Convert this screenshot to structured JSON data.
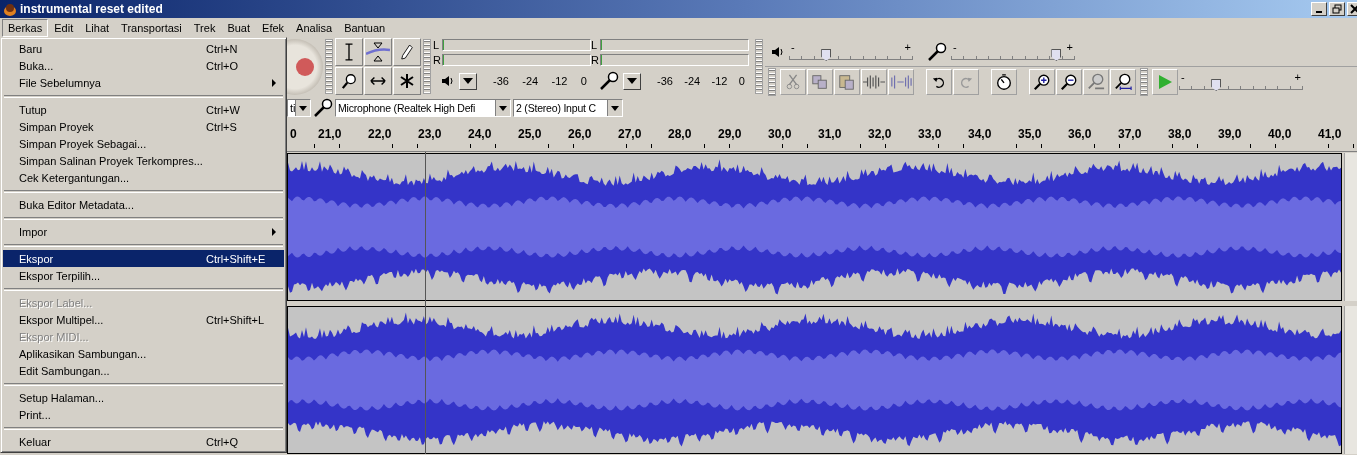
{
  "window": {
    "title": "instrumental reset edited"
  },
  "menu_bar": [
    {
      "label": "Berkas",
      "selected": true
    },
    {
      "label": "Edit",
      "selected": false
    },
    {
      "label": "Lihat",
      "selected": false
    },
    {
      "label": "Transportasi",
      "selected": false
    },
    {
      "label": "Trek",
      "selected": false
    },
    {
      "label": "Buat",
      "selected": false
    },
    {
      "label": "Efek",
      "selected": false
    },
    {
      "label": "Analisa",
      "selected": false
    },
    {
      "label": "Bantuan",
      "selected": false
    }
  ],
  "file_menu": [
    {
      "kind": "item",
      "label": "Baru",
      "shortcut": "Ctrl+N",
      "selected": false,
      "disabled": false,
      "submenu": false
    },
    {
      "kind": "item",
      "label": "Buka...",
      "shortcut": "Ctrl+O",
      "selected": false,
      "disabled": false,
      "submenu": false
    },
    {
      "kind": "item",
      "label": "File Sebelumnya",
      "selected": false,
      "disabled": false,
      "submenu": true
    },
    {
      "kind": "separator"
    },
    {
      "kind": "item",
      "label": "Tutup",
      "shortcut": "Ctrl+W",
      "selected": false,
      "disabled": false,
      "submenu": false
    },
    {
      "kind": "item",
      "label": "Simpan Proyek",
      "shortcut": "Ctrl+S",
      "selected": false,
      "disabled": false,
      "submenu": false
    },
    {
      "kind": "item",
      "label": "Simpan Proyek Sebagai...",
      "selected": false,
      "disabled": false,
      "submenu": false
    },
    {
      "kind": "item",
      "label": "Simpan Salinan Proyek Terkompres...",
      "selected": false,
      "disabled": false,
      "submenu": false
    },
    {
      "kind": "item",
      "label": "Cek Ketergantungan...",
      "selected": false,
      "disabled": false,
      "submenu": false
    },
    {
      "kind": "separator"
    },
    {
      "kind": "item",
      "label": "Buka Editor Metadata...",
      "selected": false,
      "disabled": false,
      "submenu": false
    },
    {
      "kind": "separator"
    },
    {
      "kind": "item",
      "label": "Impor",
      "selected": false,
      "disabled": false,
      "submenu": true
    },
    {
      "kind": "separator"
    },
    {
      "kind": "item",
      "label": "Ekspor",
      "shortcut": "Ctrl+Shift+E",
      "selected": true,
      "disabled": false,
      "submenu": false
    },
    {
      "kind": "item",
      "label": "Ekspor Terpilih...",
      "selected": false,
      "disabled": false,
      "submenu": false
    },
    {
      "kind": "separator"
    },
    {
      "kind": "item",
      "label": "Ekspor Label...",
      "selected": false,
      "disabled": true,
      "submenu": false
    },
    {
      "kind": "item",
      "label": "Ekspor Multipel...",
      "shortcut": "Ctrl+Shift+L",
      "selected": false,
      "disabled": false,
      "submenu": false
    },
    {
      "kind": "item",
      "label": "Ekspor MIDI...",
      "selected": false,
      "disabled": true,
      "submenu": false
    },
    {
      "kind": "item",
      "label": "Aplikasikan Sambungan...",
      "selected": false,
      "disabled": false,
      "submenu": false
    },
    {
      "kind": "item",
      "label": "Edit Sambungan...",
      "selected": false,
      "disabled": false,
      "submenu": false
    },
    {
      "kind": "separator"
    },
    {
      "kind": "item",
      "label": "Setup Halaman...",
      "selected": false,
      "disabled": false,
      "submenu": false
    },
    {
      "kind": "item",
      "label": "Print...",
      "selected": false,
      "disabled": false,
      "submenu": false
    },
    {
      "kind": "separator"
    },
    {
      "kind": "item",
      "label": "Keluar",
      "shortcut": "Ctrl+Q",
      "selected": false,
      "disabled": false,
      "submenu": false
    }
  ],
  "meters": [
    {
      "kind": "playback",
      "channels": [
        "L",
        "R"
      ],
      "scale": [
        "-36",
        "-24",
        "-12",
        "0"
      ]
    },
    {
      "kind": "recording",
      "channels": [
        "L",
        "R"
      ],
      "scale": [
        "-36",
        "-24",
        "-12",
        "0"
      ]
    }
  ],
  "mixer_sliders": [
    {
      "kind": "playback",
      "minus": "-",
      "plus": "+",
      "level": 0.3
    },
    {
      "kind": "recording",
      "minus": "-",
      "plus": "+",
      "level": 0.85
    }
  ],
  "play_speed_slider": {
    "minus": "-",
    "plus": "+",
    "level": 0.3
  },
  "device_toolbar": {
    "host": "ti",
    "input_device": "Microphone (Realtek High Defi",
    "input_channels": "2 (Stereo) Input C"
  },
  "ruler": {
    "labels": [
      "0",
      "21,0",
      "22,0",
      "23,0",
      "24,0",
      "25,0",
      "26,0",
      "27,0",
      "28,0",
      "29,0",
      "30,0",
      "31,0",
      "32,0",
      "33,0",
      "34,0",
      "35,0",
      "36,0",
      "37,0",
      "38,0",
      "39,0",
      "40,0",
      "41,0"
    ]
  }
}
